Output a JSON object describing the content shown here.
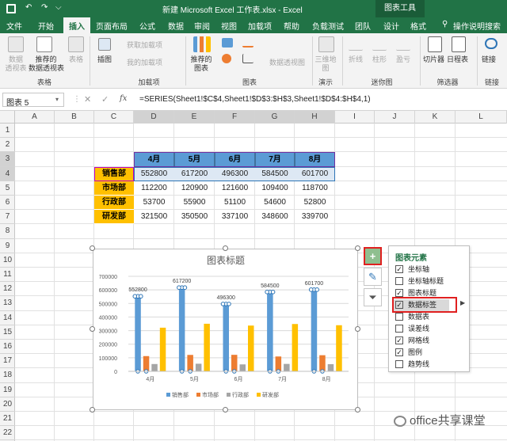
{
  "window": {
    "title": "新建 Microsoft Excel 工作表.xlsx  -  Excel",
    "context_tab": "图表工具"
  },
  "tabs": [
    "文件",
    "开始",
    "插入",
    "页面布局",
    "公式",
    "数据",
    "审阅",
    "视图",
    "加载项",
    "帮助",
    "负载测试",
    "团队",
    "设计",
    "格式"
  ],
  "active_tab": "插入",
  "tell_me": "操作说明搜索",
  "ribbon": {
    "pivot_table": "数据\n透视表",
    "recommended_pivot": "推荐的\n数据透视表",
    "table": "表格",
    "illustrations": "插图",
    "get_addins": "获取加载项",
    "my_addins": "我的加载项",
    "recommended_charts": "推荐的\n图表",
    "pivot_chart": "数据透视图",
    "map_3d": "三维地\n图",
    "spark_line": "折线",
    "spark_column": "柱形",
    "spark_winloss": "盈亏",
    "slicer": "切片器",
    "timeline": "日程表",
    "link": "链接",
    "groups": {
      "tables": "表格",
      "addins": "加载项",
      "charts": "图表",
      "tours": "演示",
      "sparklines": "迷你图",
      "filters": "筛选器",
      "links": "链接"
    }
  },
  "formula_bar": {
    "name_box": "图表 5",
    "formula": "=SERIES(Sheet1!$C$4,Sheet1!$D$3:$H$3,Sheet1!$D$4:$H$4,1)"
  },
  "columns": [
    "A",
    "B",
    "C",
    "D",
    "E",
    "F",
    "G",
    "H",
    "I",
    "J",
    "K",
    "L"
  ],
  "rows": [
    "1",
    "2",
    "3",
    "4",
    "5",
    "6",
    "7",
    "8",
    "9",
    "10",
    "11",
    "12",
    "13",
    "14",
    "15",
    "16",
    "17",
    "18",
    "19",
    "20",
    "21",
    "22"
  ],
  "table": {
    "months": [
      "4月",
      "5月",
      "6月",
      "7月",
      "8月"
    ],
    "rows": [
      {
        "dept": "销售部",
        "values": [
          "552800",
          "617200",
          "496300",
          "584500",
          "601700"
        ]
      },
      {
        "dept": "市场部",
        "values": [
          "112200",
          "120900",
          "121600",
          "109400",
          "118700"
        ]
      },
      {
        "dept": "行政部",
        "values": [
          "53700",
          "55900",
          "51100",
          "54600",
          "52800"
        ]
      },
      {
        "dept": "研发部",
        "values": [
          "321500",
          "350500",
          "337100",
          "348600",
          "339700"
        ]
      }
    ]
  },
  "chart_data": {
    "type": "bar",
    "title": "图表标题",
    "categories": [
      "4月",
      "5月",
      "6月",
      "7月",
      "8月"
    ],
    "ylim": [
      0,
      700000
    ],
    "yticks": [
      "0",
      "100000",
      "200000",
      "300000",
      "400000",
      "500000",
      "600000",
      "700000"
    ],
    "grid": true,
    "legend": "bottom",
    "series": [
      {
        "name": "销售部",
        "color": "#5b9bd5",
        "values": [
          552800,
          617200,
          496300,
          584500,
          601700
        ]
      },
      {
        "name": "市场部",
        "color": "#ed7d31",
        "values": [
          112200,
          120900,
          121600,
          109400,
          118700
        ]
      },
      {
        "name": "行政部",
        "color": "#a5a5a5",
        "values": [
          53700,
          55900,
          51100,
          54600,
          52800
        ]
      },
      {
        "name": "研发部",
        "color": "#ffc000",
        "values": [
          321500,
          350500,
          337100,
          348600,
          339700
        ]
      }
    ],
    "data_labels": [
      "552800",
      "617200",
      "496300",
      "584500",
      "601700"
    ]
  },
  "chart_elements": {
    "title": "图表元素",
    "items": [
      {
        "label": "坐标轴",
        "checked": true
      },
      {
        "label": "坐标轴标题",
        "checked": false
      },
      {
        "label": "图表标题",
        "checked": true
      },
      {
        "label": "数据标签",
        "checked": true
      },
      {
        "label": "数据表",
        "checked": false
      },
      {
        "label": "误差线",
        "checked": false
      },
      {
        "label": "网格线",
        "checked": true
      },
      {
        "label": "图例",
        "checked": true
      },
      {
        "label": "趋势线",
        "checked": false
      }
    ]
  },
  "watermark": "office共享课堂",
  "colors": {
    "excel_green": "#217346",
    "highlight_red": "#e02020"
  }
}
